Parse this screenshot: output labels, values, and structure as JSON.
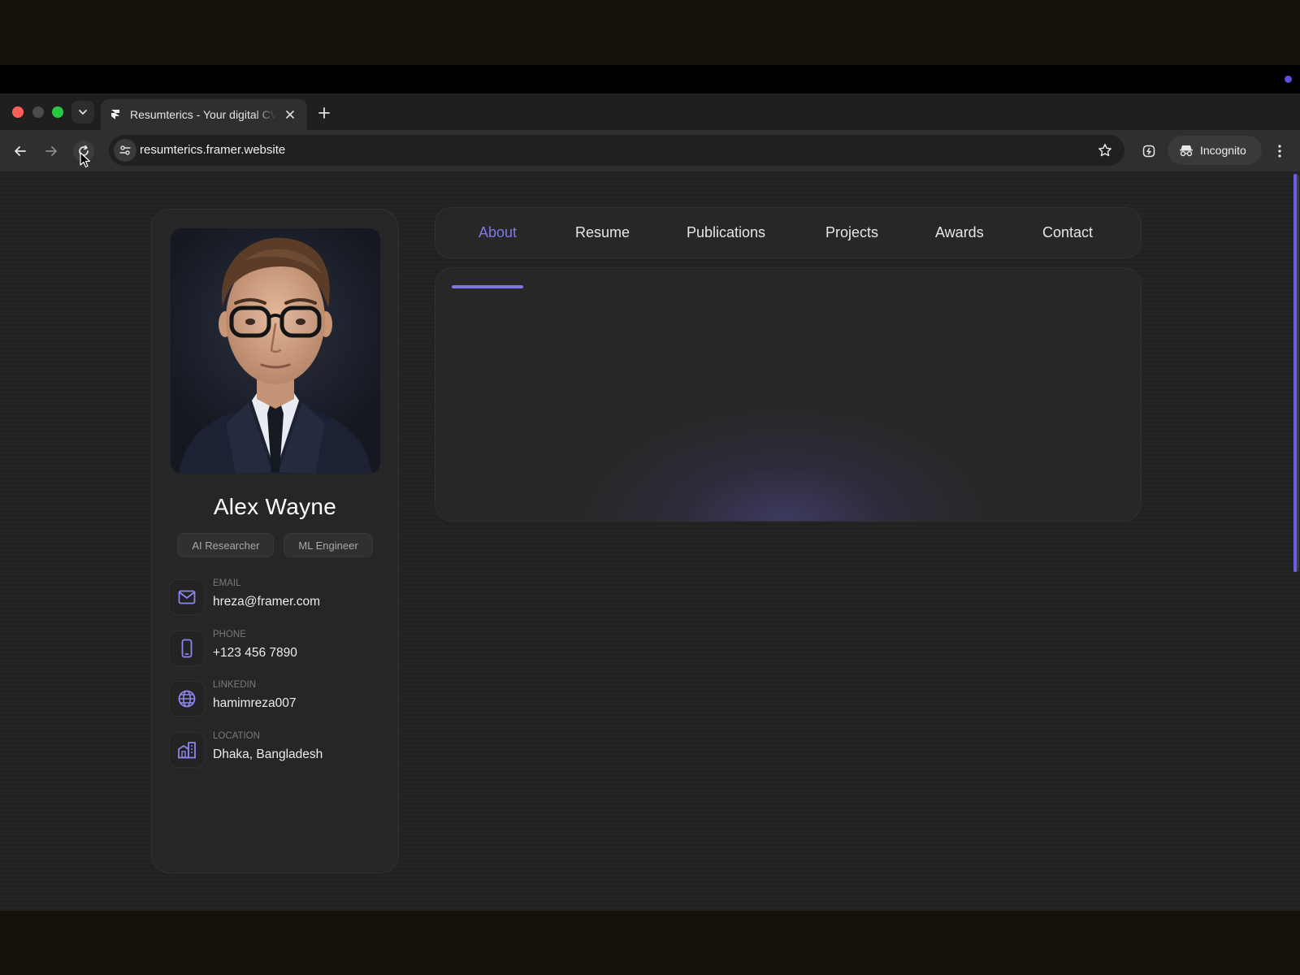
{
  "browser": {
    "tab_title": "Resumterics - Your digital CV",
    "url": "resumterics.framer.website",
    "profile_label": "Incognito"
  },
  "profile": {
    "name": "Alex Wayne",
    "roles": [
      "AI Researcher",
      "ML Engineer"
    ],
    "contacts": [
      {
        "label": "EMAIL",
        "value": "hreza@framer.com",
        "icon": "mail-icon"
      },
      {
        "label": "PHONE",
        "value": "+123 456 7890",
        "icon": "phone-icon"
      },
      {
        "label": "LINKEDIN",
        "value": "hamimreza007",
        "icon": "globe-icon"
      },
      {
        "label": "LOCATION",
        "value": "Dhaka, Bangladesh",
        "icon": "building-icon"
      }
    ]
  },
  "nav": {
    "items": [
      "About",
      "Resume",
      "Publications",
      "Projects",
      "Awards",
      "Contact"
    ],
    "active": "About"
  },
  "colors": {
    "accent": "#7d78e8",
    "card_bg": "#262626",
    "page_bg": "#232323"
  }
}
